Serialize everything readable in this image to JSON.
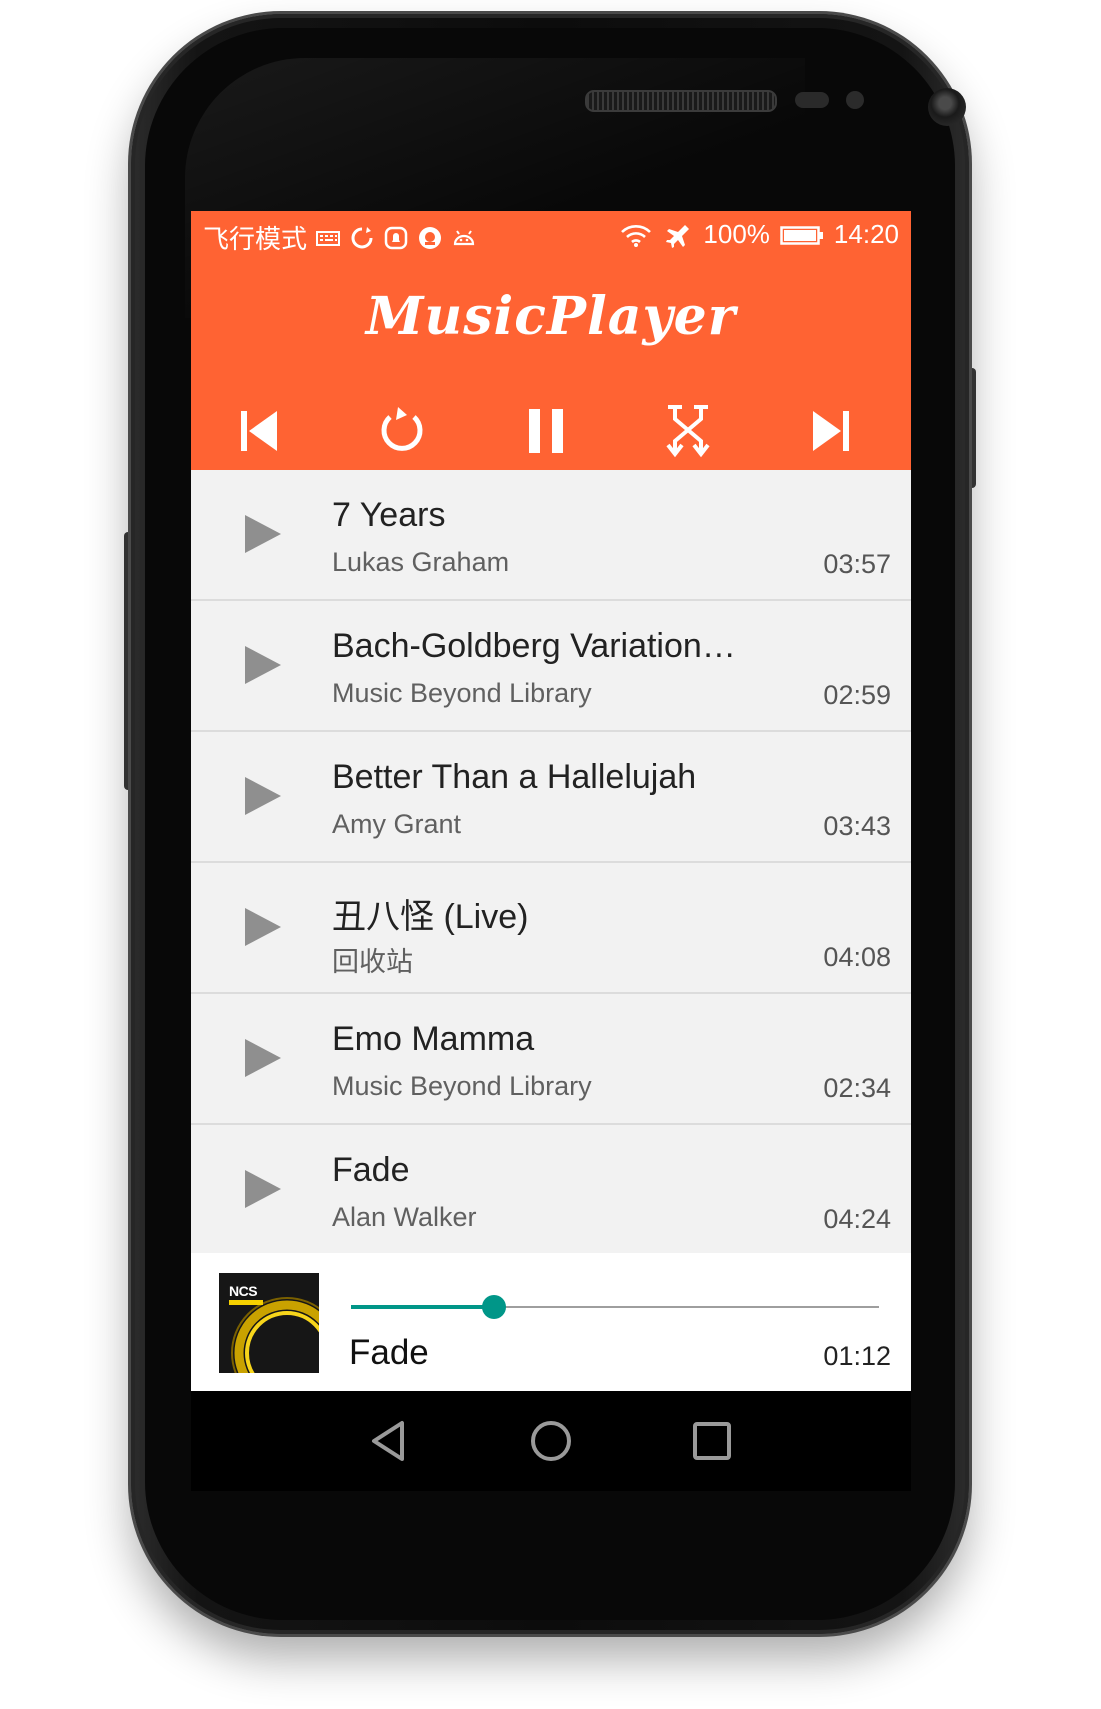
{
  "status_bar": {
    "mode_label": "飞行模式",
    "battery": "100%",
    "time": "14:20",
    "left_icons": [
      "keyboard-icon",
      "sync-icon",
      "notification-icon",
      "chat-icon",
      "android-icon"
    ],
    "right_icons": [
      "wifi-icon",
      "airplane-icon",
      "battery-icon"
    ]
  },
  "app": {
    "title": "MusicPlayer",
    "header_color": "#ff6333",
    "accent_color": "#009688"
  },
  "controls": [
    "previous-icon",
    "repeat-icon",
    "pause-icon",
    "shuffle-icon",
    "next-icon"
  ],
  "songs": [
    {
      "title": "7 Years",
      "artist": "Lukas Graham",
      "duration": "03:57"
    },
    {
      "title": "Bach-Goldberg Variations 1...",
      "artist": "Music Beyond Library",
      "duration": "02:59"
    },
    {
      "title": "Better Than a Hallelujah",
      "artist": "Amy Grant",
      "duration": "03:43"
    },
    {
      "title": "丑八怪 (Live)",
      "artist": "回收站",
      "duration": "04:08"
    },
    {
      "title": "Emo Mamma",
      "artist": "Music Beyond Library",
      "duration": "02:34"
    },
    {
      "title": "Fade",
      "artist": "Alan Walker",
      "duration": "04:24"
    }
  ],
  "now_playing": {
    "title": "Fade",
    "elapsed": "01:12",
    "progress": 0.27,
    "cover_label": "NCS"
  },
  "nav": [
    "back-icon",
    "home-icon",
    "recents-icon"
  ]
}
